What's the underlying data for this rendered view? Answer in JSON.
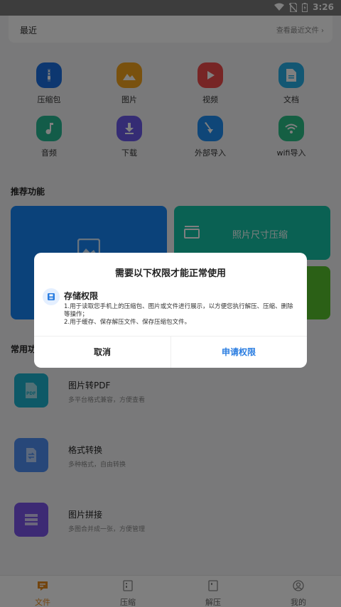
{
  "status_bar": {
    "time": "3:26"
  },
  "recent": {
    "title": "最近",
    "more": "查看最近文件 ›"
  },
  "categories": [
    {
      "label": "压缩包",
      "icon": "zip-icon",
      "color": "#1a6fe0"
    },
    {
      "label": "图片",
      "icon": "image-icon",
      "color": "#f2a21d"
    },
    {
      "label": "视频",
      "icon": "video-icon",
      "color": "#ef4b4b"
    },
    {
      "label": "文档",
      "icon": "document-icon",
      "color": "#26aee6"
    },
    {
      "label": "音频",
      "icon": "music-icon",
      "color": "#26b892"
    },
    {
      "label": "下载",
      "icon": "download-icon",
      "color": "#6a58e8"
    },
    {
      "label": "外部导入",
      "icon": "import-icon",
      "color": "#1f8cf0"
    },
    {
      "label": "wifi导入",
      "icon": "wifi-icon",
      "color": "#2bbf87"
    }
  ],
  "recommended": {
    "title": "推荐功能",
    "cards": [
      {
        "label": "照片尺寸压缩"
      }
    ]
  },
  "common": {
    "title": "常用功能",
    "items": [
      {
        "title": "图片转PDF",
        "desc": "多平台格式兼容，方便查看",
        "icon": "pdf-icon",
        "color": "#1db3cf"
      },
      {
        "title": "格式转换",
        "desc": "多种格式，自由转换",
        "icon": "convert-icon",
        "color": "#4f8ff2"
      },
      {
        "title": "图片拼接",
        "desc": "多图合并成一张，方便管理",
        "icon": "stitch-icon",
        "color": "#7b54e8"
      }
    ]
  },
  "tabs": [
    {
      "label": "文件",
      "icon": "file-tab-icon",
      "active": true
    },
    {
      "label": "压缩",
      "icon": "compress-tab-icon",
      "active": false
    },
    {
      "label": "解压",
      "icon": "extract-tab-icon",
      "active": false
    },
    {
      "label": "我的",
      "icon": "profile-tab-icon",
      "active": false
    }
  ],
  "dialog": {
    "title": "需要以下权限才能正常使用",
    "permission_title": "存储权限",
    "permission_desc_1": "1.用于读取您手机上的压缩包、图片或文件进行展示，以方便您执行解压、压缩、删除等操作；",
    "permission_desc_2": "2.用于缓存、保存解压文件、保存压缩包文件。",
    "cancel": "取消",
    "confirm": "申请权限"
  },
  "colors": {
    "accent_tab": "#e68a1e",
    "dialog_confirm": "#2a7de1"
  }
}
